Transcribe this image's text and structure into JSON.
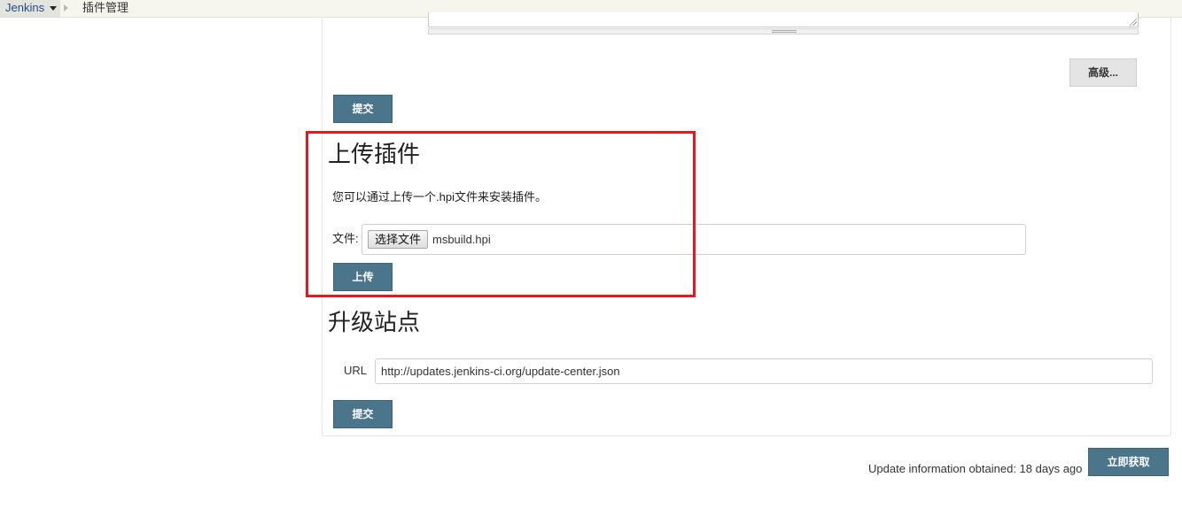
{
  "breadcrumb": {
    "root": "Jenkins",
    "current": "插件管理"
  },
  "advanced": {
    "advanced_label": "高级..."
  },
  "top_form": {
    "submit_label": "提交"
  },
  "upload_plugin": {
    "title": "上传插件",
    "description": "您可以通过上传一个.hpi文件来安装插件。",
    "file_label": "文件:",
    "choose_file_label": "选择文件",
    "selected_file": "msbuild.hpi",
    "upload_label": "上传"
  },
  "update_site": {
    "title": "升级站点",
    "url_label": "URL",
    "url_value": "http://updates.jenkins-ci.org/update-center.json",
    "submit_label": "提交"
  },
  "footer": {
    "update_info": "Update information obtained: 18 days ago",
    "fetch_now_label": "立即获取"
  },
  "colors": {
    "primary_button": "#4b758b",
    "highlight_border": "#e8161f"
  }
}
